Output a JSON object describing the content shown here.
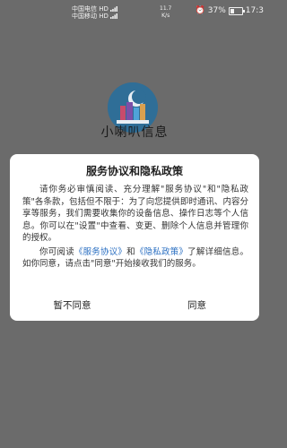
{
  "status_bar": {
    "carrier1": "中国电信 HD",
    "carrier2": "中国移动 HD",
    "speed_value": "11.7",
    "speed_unit": "K/s",
    "alarm_icon": "alarm-icon",
    "battery_percent": "37%",
    "battery_level": 0.37,
    "time": "17:3"
  },
  "app": {
    "name": "小喇叭信息",
    "logo_icon": "app-logo-icon"
  },
  "dialog": {
    "title": "服务协议和隐私政策",
    "paragraph1": "请你务必审慎阅读、充分理解\"服务协议\"和\"隐私政策\"各条款，包括但不限于：为了向您提供即时通讯、内容分享等服务，我们需要收集你的设备信息、操作日志等个人信息。你可以在\"设置\"中查看、变更、删除个人信息并管理你的授权。",
    "p2_prefix": "你可阅读",
    "link_service": "《服务协议》",
    "p2_and": "和",
    "link_privacy": "《隐私政策》",
    "p2_suffix": "了解详细信息。如你同意，请点击\"同意\"开始接收我们的服务。",
    "disagree_label": "暂不同意",
    "agree_label": "同意"
  },
  "colors": {
    "overlay": "#6b6b6b",
    "link": "#2a6fc2",
    "logo_bg": "#2f6e97"
  }
}
